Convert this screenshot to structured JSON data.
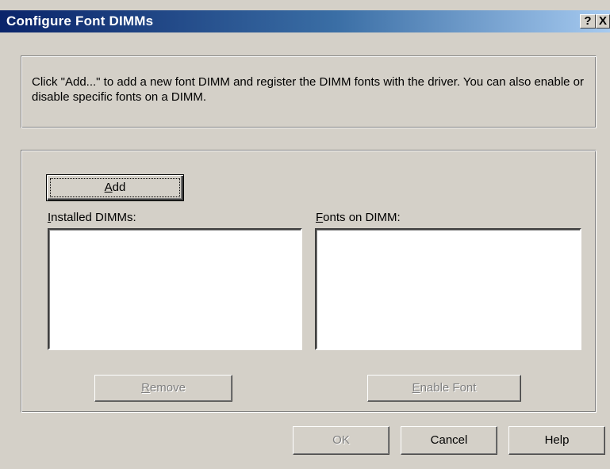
{
  "window": {
    "title": "Configure Font DIMMs",
    "help_button": "?",
    "close_button": "X"
  },
  "description": "Click \"Add...\" to add a new font DIMM and register the DIMM fonts with the driver.  You can also enable or disable specific fonts on a DIMM.",
  "main": {
    "add_button": {
      "mnemonic": "A",
      "rest": "dd"
    },
    "installed_label": {
      "mnemonic": "I",
      "rest": "nstalled DIMMs:"
    },
    "fonts_label": {
      "mnemonic": "F",
      "rest": "onts on DIMM:"
    },
    "installed_items": [],
    "font_items": [],
    "remove_button": {
      "mnemonic": "R",
      "rest": "emove",
      "enabled": false
    },
    "enable_font_button": {
      "mnemonic": "E",
      "rest": "nable Font",
      "enabled": false
    }
  },
  "footer": {
    "ok_label": "OK",
    "ok_enabled": false,
    "cancel_label": "Cancel",
    "help_label": "Help"
  }
}
